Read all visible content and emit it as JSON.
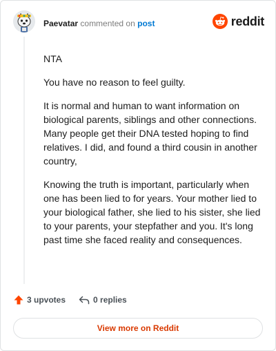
{
  "header": {
    "author": "Paevatar",
    "commented_on": "commented on",
    "post_link": "post"
  },
  "brand": {
    "name": "reddit",
    "icon": "reddit-snoo-icon",
    "color": "#ff4500"
  },
  "comment": {
    "paragraphs": [
      "NTA",
      "You have no reason to feel guilty.",
      "It is normal and human to want information on biological parents, siblings and other connections. Many people get their DNA tested hoping to find relatives. I did, and found a third cousin in another country,",
      "Knowing the truth is important, particularly when one has been lied to for years. Your mother lied to your biological father, she lied to his sister, she lied to your parents, your stepfather and you. It's long past time she faced reality and consequences."
    ]
  },
  "actions": {
    "upvotes": "3 upvotes",
    "replies": "0 replies",
    "upvote_icon": "upvote-arrow-icon",
    "reply_icon": "reply-arrow-icon",
    "upvote_color": "#ff4500"
  },
  "footer": {
    "view_more": "View more on Reddit"
  }
}
